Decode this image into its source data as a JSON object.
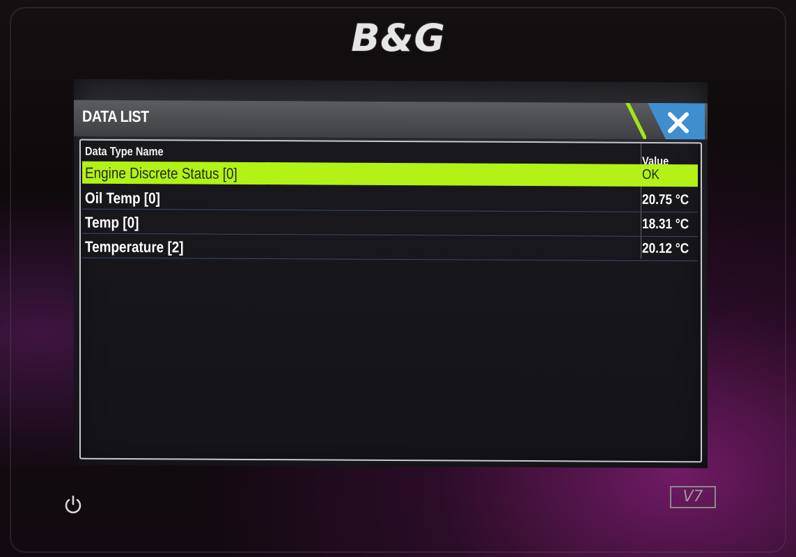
{
  "device": {
    "brand": "B&G",
    "model": "V7"
  },
  "dialog": {
    "title": "DATA LIST",
    "close_icon": "close-icon",
    "columns": {
      "name": "Data Type Name",
      "value": "Value"
    },
    "rows": [
      {
        "name": "Engine Discrete Status [0]",
        "value": "OK",
        "selected": true
      },
      {
        "name": "Oil Temp [0]",
        "value": "20.75 °C",
        "selected": false
      },
      {
        "name": "Temp [0]",
        "value": "18.31 °C",
        "selected": false
      },
      {
        "name": "Temperature [2]",
        "value": "20.12 °C",
        "selected": false
      }
    ]
  },
  "colors": {
    "selection": "#b2f217",
    "close_button": "#3f8fd0",
    "accent": "#9ee61a"
  },
  "icons": {
    "power": "power-icon"
  }
}
